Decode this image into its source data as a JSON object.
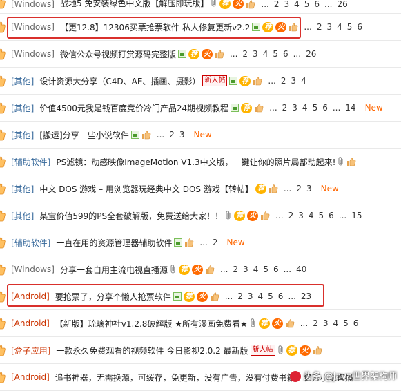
{
  "rows": [
    {
      "cat": "[Windows]",
      "cat_color": "gray",
      "title": "战地5 免安装绿色中文版【解压即玩版】",
      "icons": [
        "clip",
        "rec",
        "hot",
        "like"
      ],
      "pages": [
        "...",
        "2",
        "3",
        "4",
        "5",
        "6",
        "...",
        "26"
      ],
      "newt": ""
    },
    {
      "cat": "[Windows]",
      "cat_color": "gray",
      "title": "【更12.8】12306买票抢票软件-私人修复更新v2.2",
      "icons": [
        "img",
        "rec",
        "hot",
        "like"
      ],
      "pages": [
        "...",
        "2",
        "3",
        "4",
        "5",
        "6"
      ],
      "newt": ""
    },
    {
      "cat": "[Windows]",
      "cat_color": "gray",
      "title": "微信公众号视频打赏源码完整版",
      "icons": [
        "img",
        "rec",
        "hot",
        "like"
      ],
      "pages": [
        "...",
        "2",
        "3",
        "4",
        "5",
        "6",
        "...",
        "26"
      ],
      "newt": ""
    },
    {
      "cat": "[其他]",
      "cat_color": "blue",
      "title": "设计资源大分享（C4D、AE、插画、摄影）",
      "icons": [
        "new",
        "img",
        "rec",
        "like"
      ],
      "pages": [
        "...",
        "2",
        "3",
        "4"
      ],
      "newt": ""
    },
    {
      "cat": "[其他]",
      "cat_color": "blue",
      "title": "价值4500元我是钱百度竞价冷门产品24期视频教程",
      "icons": [
        "img",
        "rec",
        "like"
      ],
      "pages": [
        "...",
        "2",
        "3",
        "4",
        "5",
        "6",
        "...",
        "14"
      ],
      "newt": "New"
    },
    {
      "cat": "[其他]",
      "cat_color": "blue",
      "title": "[搬运]分享一些小说软件",
      "icons": [
        "img",
        "like"
      ],
      "pages": [
        "...",
        "2",
        "3"
      ],
      "newt": "New"
    },
    {
      "cat": "[辅助软件]",
      "cat_color": "blue",
      "title": "PS滤镜：动感映像ImageMotion V1.3中文版，一键让你的照片局部动起来!",
      "icons": [
        "clip",
        "like"
      ],
      "pages": [],
      "newt": ""
    },
    {
      "cat": "[其他]",
      "cat_color": "blue",
      "title": "中文 DOS 游戏 – 用浏览器玩经典中文 DOS 游戏【转帖】",
      "icons": [
        "rec",
        "like"
      ],
      "pages": [
        "...",
        "2",
        "3"
      ],
      "newt": "New"
    },
    {
      "cat": "[其他]",
      "cat_color": "blue",
      "title": "某宝价值599的PS全套破解版，免费送给大家！！",
      "icons": [
        "clip",
        "rec",
        "hot",
        "like"
      ],
      "pages": [
        "...",
        "2",
        "3",
        "4",
        "5",
        "6",
        "...",
        "15"
      ],
      "newt": ""
    },
    {
      "cat": "[辅助软件]",
      "cat_color": "blue",
      "title": "一直在用的资源管理器辅助软件",
      "icons": [
        "img",
        "like"
      ],
      "pages": [
        "...",
        "2"
      ],
      "newt": "New"
    },
    {
      "cat": "[Windows]",
      "cat_color": "gray",
      "title": "分享一套自用主流电视直播源",
      "icons": [
        "clip",
        "rec",
        "hot",
        "like"
      ],
      "pages": [
        "...",
        "2",
        "3",
        "4",
        "5",
        "6",
        "...",
        "40"
      ],
      "newt": ""
    },
    {
      "cat": "[Android]",
      "cat_color": "red",
      "title": "要抢票了，分享个懒人抢票软件",
      "icons": [
        "img",
        "rec",
        "hot",
        "like"
      ],
      "pages": [
        "...",
        "2",
        "3",
        "4",
        "5",
        "6",
        "...",
        "23"
      ],
      "newt": ""
    },
    {
      "cat": "[Android]",
      "cat_color": "red",
      "title": "【新版】琉璃神社v1.2.8破解版 ★所有漫画免费看★",
      "icons": [
        "clip",
        "rec",
        "hot",
        "like"
      ],
      "pages": [
        "...",
        "2",
        "3",
        "4",
        "5",
        "6"
      ],
      "newt": ""
    },
    {
      "cat": "[盒子应用]",
      "cat_color": "red",
      "title": "一款永久免费观看的视频软件 今日影视2.0.2 最新版",
      "icons": [
        "new",
        "clip",
        "rec",
        "hot",
        "like"
      ],
      "pages": [],
      "newt": ""
    },
    {
      "cat": "[Android]",
      "cat_color": "red",
      "title": "追书神器，无需换源，可缓存，免更新，没有广告，没有付费书籍，亿万小说直播",
      "icons": [],
      "pages": [],
      "newt": ""
    }
  ],
  "labels": {
    "rec": "荐",
    "hot": "火",
    "new": "新人帖"
  },
  "watermark": "头条 @Java世界架构师"
}
